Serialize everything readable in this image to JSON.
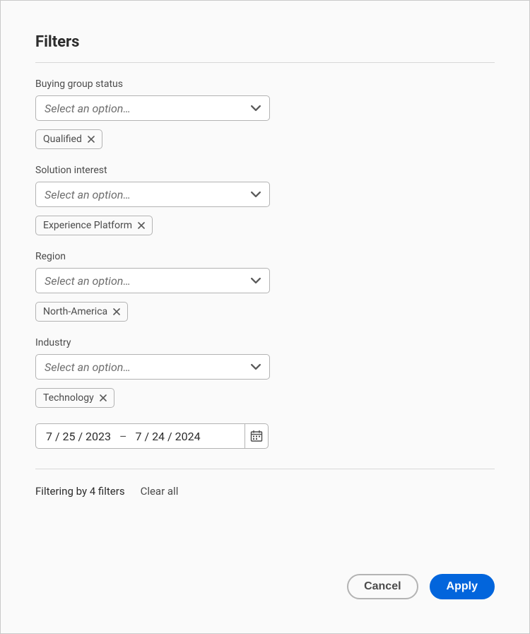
{
  "title": "Filters",
  "placeholder": "Select an option…",
  "fields": {
    "buying_group_status": {
      "label": "Buying group status",
      "tags": [
        "Qualified"
      ]
    },
    "solution_interest": {
      "label": "Solution interest",
      "tags": [
        "Experience Platform"
      ]
    },
    "region": {
      "label": "Region",
      "tags": [
        "North-America"
      ]
    },
    "industry": {
      "label": "Industry",
      "tags": [
        "Technology"
      ]
    }
  },
  "date_range": {
    "start": "7 / 25 / 2023",
    "end": "7 / 24 / 2024",
    "separator": "–"
  },
  "summary": {
    "text": "Filtering by 4 filters",
    "clear": "Clear all"
  },
  "buttons": {
    "cancel": "Cancel",
    "apply": "Apply"
  },
  "colors": {
    "primary": "#0265dc",
    "border": "#b3b3b3",
    "bg": "#fafafa"
  }
}
